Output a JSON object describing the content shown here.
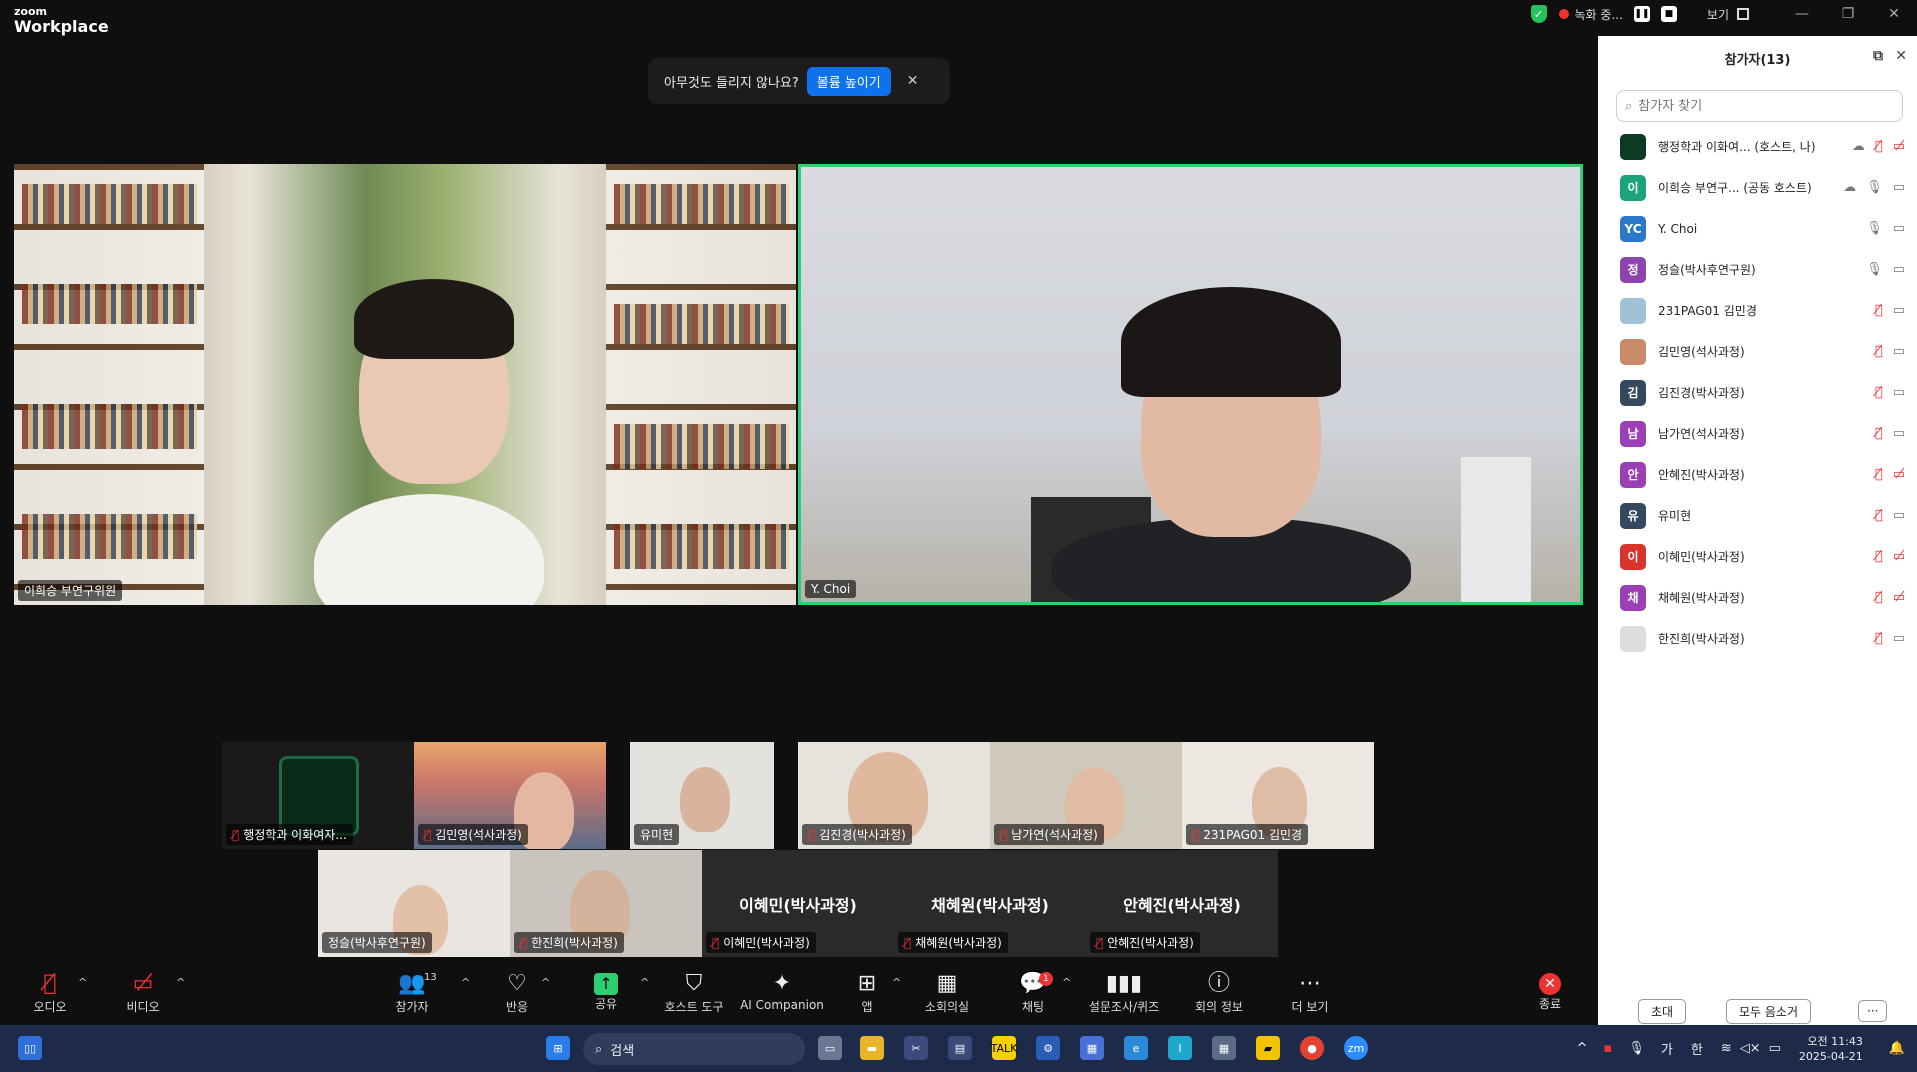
{
  "app": {
    "logo_top": "zoom",
    "logo_bottom": "Workplace",
    "recording_label": "녹화 중...",
    "view_label": "보기",
    "window_min": "—",
    "window_restore": "❐",
    "window_close": "✕"
  },
  "banner": {
    "message": "아무것도 들리지 않나요?",
    "button_label": "볼륨 높이기",
    "close": "✕"
  },
  "main_videos": [
    {
      "name": "이희승 부연구위원"
    },
    {
      "name": "Y. Choi"
    }
  ],
  "gallery": [
    {
      "name": "행정학과 이화여자..."
    },
    {
      "name": "김민영(석사과정)"
    },
    {
      "name": "유미현"
    },
    {
      "name": "김진경(박사과정)"
    },
    {
      "name": "남가연(석사과정)"
    },
    {
      "name": "231PAG01 김민경"
    },
    {
      "name": "정슬(박사후연구원)"
    },
    {
      "name": "한진희(박사과정)"
    },
    {
      "name": "이혜민(박사과정)",
      "big": "이혜민(박사과정)"
    },
    {
      "name": "채혜원(박사과정)",
      "big": "채혜원(박사과정)"
    },
    {
      "name": "안혜진(박사과정)",
      "big": "안혜진(박사과정)"
    }
  ],
  "toolbar": {
    "audio": "오디오",
    "video": "비디오",
    "participants": "참가자",
    "participants_count": "13",
    "reactions": "반응",
    "share": "공유",
    "host_tools": "호스트 도구",
    "ai": "AI Companion",
    "apps": "앱",
    "breakout": "소회의실",
    "chat": "채팅",
    "chat_badge": "1",
    "polls": "설문조사/퀴즈",
    "meeting_info": "회의 정보",
    "more": "더 보기",
    "end": "종료"
  },
  "panel": {
    "title": "참가자(13)",
    "search_placeholder": "참가자 찾기",
    "participants": [
      {
        "avatar": "",
        "color": "#0d3a23",
        "name": "행정학과 이화여... (호스트, 나)",
        "mic": "off",
        "cam": "off",
        "cloud": true
      },
      {
        "avatar": "이",
        "color": "#1ba37b",
        "name": "이희승 부연구... (공동 호스트)",
        "mic": "on",
        "cam": "on",
        "cloud": true
      },
      {
        "avatar": "YC",
        "color": "#2a78c9",
        "name": "Y. Choi",
        "mic": "on",
        "cam": "on"
      },
      {
        "avatar": "정",
        "color": "#8e44ad",
        "name": "정슬(박사후연구원)",
        "mic": "on",
        "cam": "on"
      },
      {
        "avatar": "",
        "color": "#9fc2d6",
        "name": "231PAG01 김민경",
        "mic": "off",
        "cam": "on"
      },
      {
        "avatar": "",
        "color": "#c98a6a",
        "name": "김민영(석사과정)",
        "mic": "off",
        "cam": "on"
      },
      {
        "avatar": "김",
        "color": "#34495e",
        "name": "김진경(박사과정)",
        "mic": "off",
        "cam": "on"
      },
      {
        "avatar": "남",
        "color": "#9b3fb5",
        "name": "남가연(석사과정)",
        "mic": "off",
        "cam": "on"
      },
      {
        "avatar": "안",
        "color": "#9b3fb5",
        "name": "안혜진(박사과정)",
        "mic": "off",
        "cam": "off"
      },
      {
        "avatar": "유",
        "color": "#34495e",
        "name": "유미현",
        "mic": "off",
        "cam": "on"
      },
      {
        "avatar": "이",
        "color": "#d9342b",
        "name": "이혜민(박사과정)",
        "mic": "off",
        "cam": "off"
      },
      {
        "avatar": "채",
        "color": "#9b3fb5",
        "name": "채혜원(박사과정)",
        "mic": "off",
        "cam": "off"
      },
      {
        "avatar": "",
        "color": "#dddddd",
        "name": "한진희(박사과정)",
        "mic": "off",
        "cam": "on"
      }
    ],
    "invite": "초대",
    "mute_all": "모두 음소거",
    "more": "···"
  },
  "taskbar": {
    "search_label": "검색",
    "ime1": "가",
    "ime2": "한",
    "time_line1": "오전 11:43",
    "time_line2": "2025-04-21"
  }
}
